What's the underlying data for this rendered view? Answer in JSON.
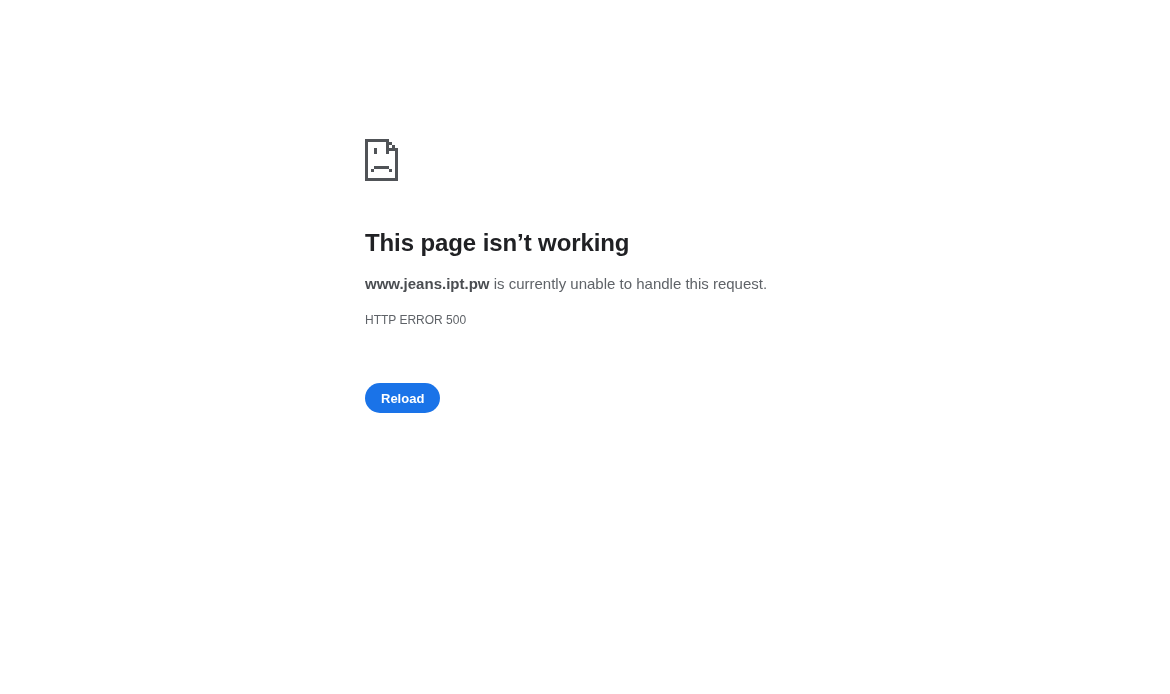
{
  "error_page": {
    "heading": "This page isn’t working",
    "message": "**www.jeans.ipt.pw** is currently unable to handle this request.",
    "error_code": "HTTP ERROR 500",
    "buttons": [
      {
        "label": "Reload",
        "kind": "primary"
      }
    ]
  }
}
